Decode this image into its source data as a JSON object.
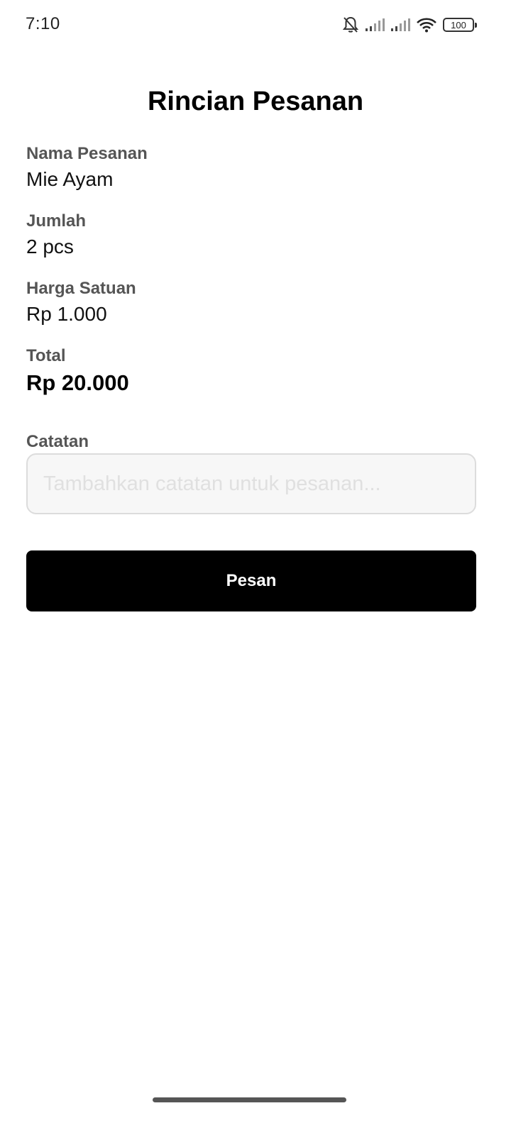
{
  "status_bar": {
    "time": "7:10",
    "battery_level": "100",
    "icons": [
      "bell-off-icon",
      "signal-icon",
      "signal-icon",
      "wifi-icon",
      "battery-icon"
    ]
  },
  "page": {
    "title": "Rincian Pesanan"
  },
  "details": {
    "name_label": "Nama Pesanan",
    "name_value": "Mie Ayam",
    "qty_label": "Jumlah",
    "qty_value": "2 pcs",
    "unit_price_label": "Harga Satuan",
    "unit_price_value": "Rp 1.000",
    "total_label": "Total",
    "total_value": "Rp 20.000"
  },
  "notes": {
    "label": "Catatan",
    "placeholder": "Tambahkan catatan untuk pesanan...",
    "value": ""
  },
  "actions": {
    "order_label": "Pesan"
  },
  "colors": {
    "button_bg": "#000000",
    "button_text": "#ffffff",
    "label_color": "#555555"
  }
}
